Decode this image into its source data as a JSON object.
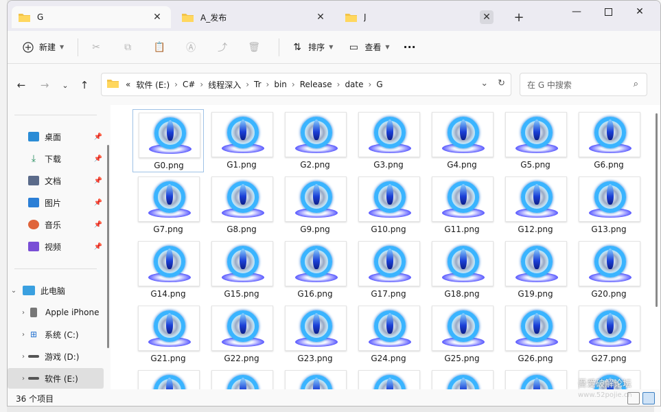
{
  "tabs": [
    {
      "label": "G",
      "active": true
    },
    {
      "label": "A_发布",
      "active": false
    },
    {
      "label": "J",
      "active": false
    }
  ],
  "toolbar": {
    "new_label": "新建",
    "sort_label": "排序",
    "view_label": "查看",
    "more_label": "···"
  },
  "breadcrumb": {
    "overflow": "«",
    "segments": [
      "软件 (E:)",
      "C#",
      "线程深入",
      "Tr",
      "bin",
      "Release",
      "date",
      "G"
    ]
  },
  "search": {
    "placeholder": "在 G 中搜索"
  },
  "sidebar": {
    "quick": [
      {
        "label": "桌面",
        "icon": "desktop-icon",
        "color": "#2b8cd6"
      },
      {
        "label": "下载",
        "icon": "download-icon",
        "color": "#1f8a5a"
      },
      {
        "label": "文档",
        "icon": "document-icon",
        "color": "#5b6b8a"
      },
      {
        "label": "图片",
        "icon": "picture-icon",
        "color": "#2b7fd6"
      },
      {
        "label": "音乐",
        "icon": "music-icon",
        "color": "#e0643a"
      },
      {
        "label": "视频",
        "icon": "video-icon",
        "color": "#7a4fd6"
      }
    ],
    "this_pc": "此电脑",
    "devices": [
      {
        "label": "Apple iPhone",
        "icon": "phone-icon"
      },
      {
        "label": "系统 (C:)",
        "icon": "windows-drive-icon"
      },
      {
        "label": "游戏 (D:)",
        "icon": "drive-icon"
      },
      {
        "label": "软件 (E:)",
        "icon": "drive-icon",
        "selected": true
      }
    ]
  },
  "files": [
    "G0.png",
    "G1.png",
    "G2.png",
    "G3.png",
    "G4.png",
    "G5.png",
    "G6.png",
    "G7.png",
    "G8.png",
    "G9.png",
    "G10.png",
    "G11.png",
    "G12.png",
    "G13.png",
    "G14.png",
    "G15.png",
    "G16.png",
    "G17.png",
    "G18.png",
    "G19.png",
    "G20.png",
    "G21.png",
    "G22.png",
    "G23.png",
    "G24.png",
    "G25.png",
    "G26.png",
    "G27.png",
    "",
    "",
    "",
    "",
    "",
    "",
    ""
  ],
  "status": {
    "count": "36 个项目"
  },
  "watermark": {
    "line1": "吾爱破解论坛",
    "line2": "www.52pojie.cn"
  }
}
